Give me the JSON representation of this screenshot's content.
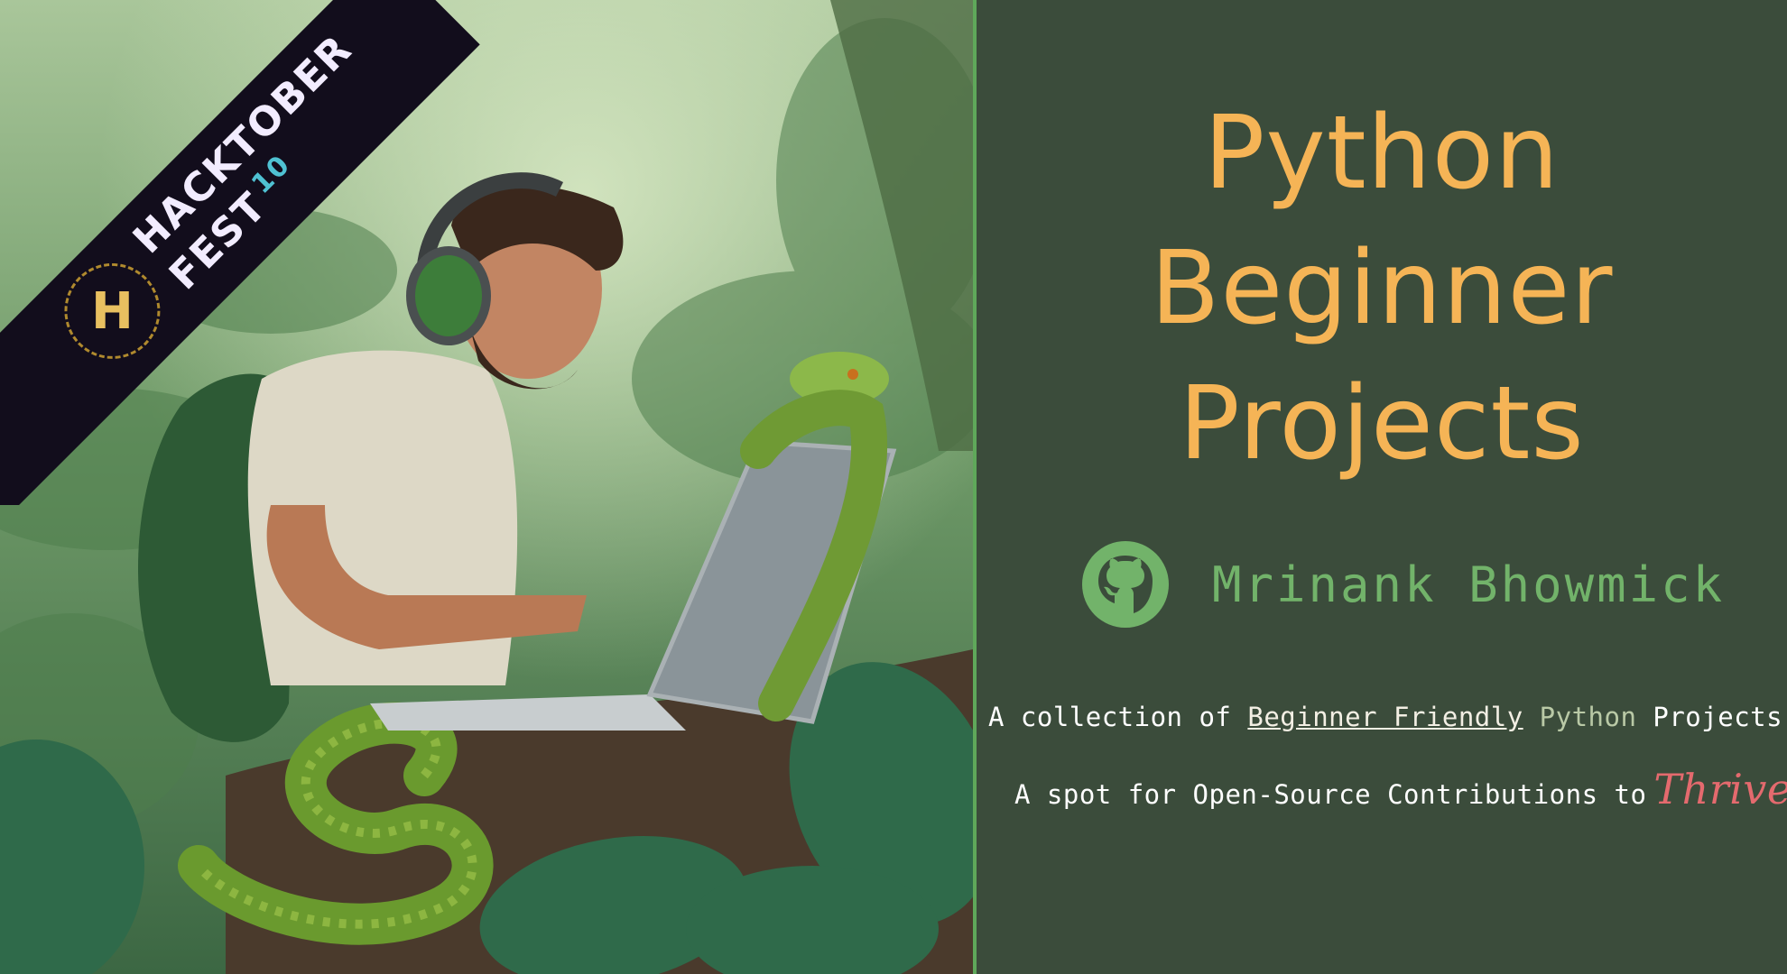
{
  "title_lines": [
    "Python",
    "Beginner",
    "Projects"
  ],
  "author": {
    "name": "Mrinank Bhowmick",
    "icon": "github-icon"
  },
  "tagline": {
    "line1_prefix": "A collection of",
    "line1_link": "Beginner Friendly",
    "line1_python": "Python",
    "line1_suffix": "Projects,",
    "line2_prefix": "A spot for Open-Source Contributions to",
    "line2_accent": "Thrive"
  },
  "ribbon": {
    "line1": "HACKTOBER",
    "line2": "FEST",
    "edition": "10",
    "badge": "H"
  },
  "colors": {
    "background": "#3b4c3b",
    "title": "#f5b456",
    "author": "#72b36a",
    "accent": "#e46a6e",
    "divider": "#5fa85a"
  }
}
